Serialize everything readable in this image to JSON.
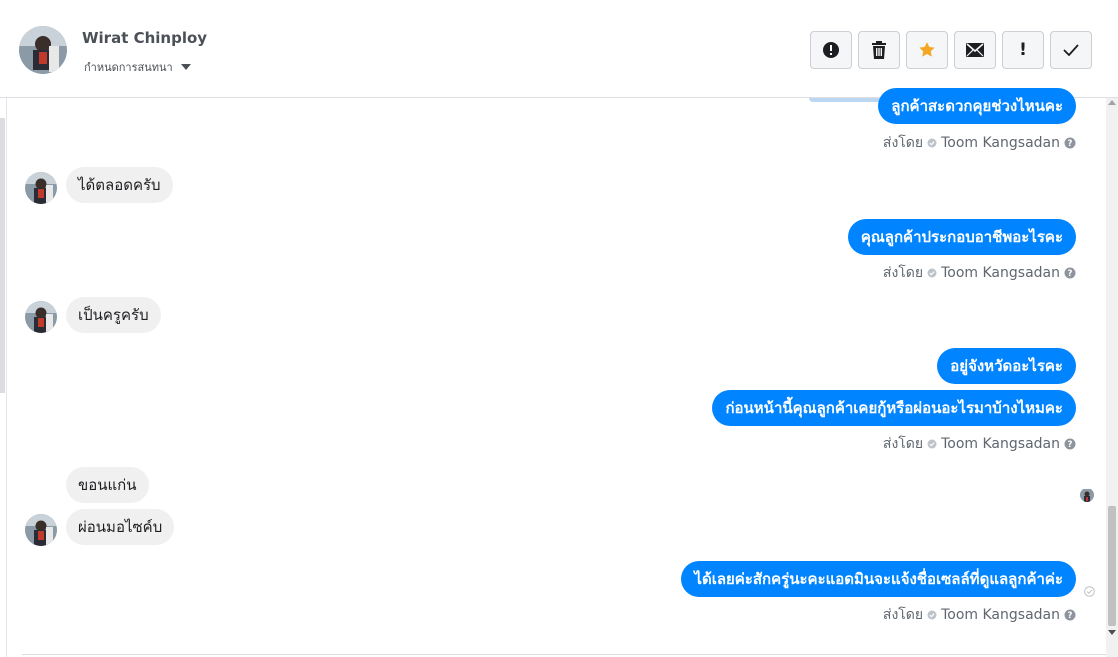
{
  "header": {
    "name": "Wirat Chinploy",
    "subtitle": "กำหนดการสนทนา"
  },
  "actions": [
    {
      "icon": "alert-circle-icon",
      "label": ""
    },
    {
      "icon": "trash-icon",
      "label": ""
    },
    {
      "icon": "star-icon",
      "label": "",
      "color": "#f5a623"
    },
    {
      "icon": "envelope-icon",
      "label": ""
    },
    {
      "icon": "exclamation-icon",
      "label": "!"
    },
    {
      "icon": "check-icon",
      "label": ""
    }
  ],
  "messages": [
    {
      "side": "out",
      "text": "ลูกค้าสะดวกคุยช่วงไหนคะ"
    },
    {
      "side": "in",
      "text": "ได้ตลอดครับ"
    },
    {
      "side": "out",
      "text": "คุณลูกค้าประกอบอาชีพอะไรคะ"
    },
    {
      "side": "in",
      "text": "เป็นครูครับ"
    },
    {
      "side": "out",
      "text": "อยู่จังหวัดอะไรคะ"
    },
    {
      "side": "out",
      "text": "ก่อนหน้านี้คุณลูกค้าเคยกู้หรือผ่อนอะไรมาบ้างไหมคะ"
    },
    {
      "side": "in",
      "text": "ขอนแก่น"
    },
    {
      "side": "in",
      "text": "ผ่อนมอไซค์บ"
    },
    {
      "side": "out",
      "text": "ได้เลยค่ะสักครู่นะคะแอดมินจะแจ้งชื่อเซลล์ที่ดูแลลูกค้าค่ะ"
    }
  ],
  "sent_by": {
    "prefix": "ส่งโดย",
    "agent": "Toom Kangsadan"
  },
  "colors": {
    "outgoing_bubble": "#0084ff",
    "incoming_bubble": "#f1f0f0",
    "star": "#f5a623"
  }
}
